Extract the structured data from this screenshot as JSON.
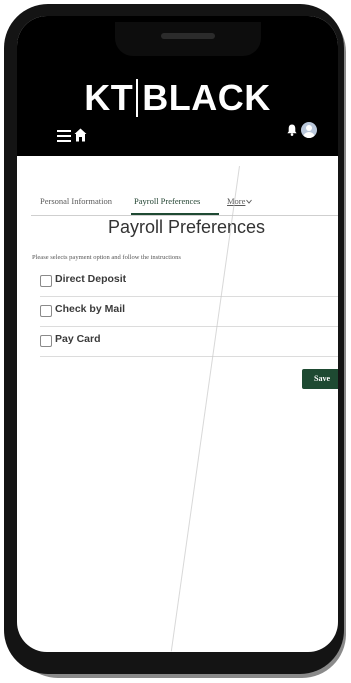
{
  "app": {
    "logo_left": "KT",
    "logo_right": "BLACK"
  },
  "header": {
    "menu_icon": "hamburger-menu-icon",
    "home_icon": "home-icon",
    "bell_icon": "bell-icon",
    "avatar_icon": "user-avatar-icon"
  },
  "tabs": [
    {
      "label": "Personal Information",
      "active": false
    },
    {
      "label": "Payroll Preferences",
      "active": true
    },
    {
      "label": "More",
      "active": false
    }
  ],
  "page": {
    "title": "Payroll Preferences",
    "instructions": "Please selects payment option and follow the instructions"
  },
  "options": [
    {
      "label": "Direct Deposit",
      "checked": false
    },
    {
      "label": "Check by Mail",
      "checked": false
    },
    {
      "label": "Pay Card",
      "checked": false
    }
  ],
  "actions": {
    "save_label": "Save"
  },
  "colors": {
    "accent_green": "#1e4a32",
    "header_bg": "#000000",
    "phone_body": "#141414"
  }
}
